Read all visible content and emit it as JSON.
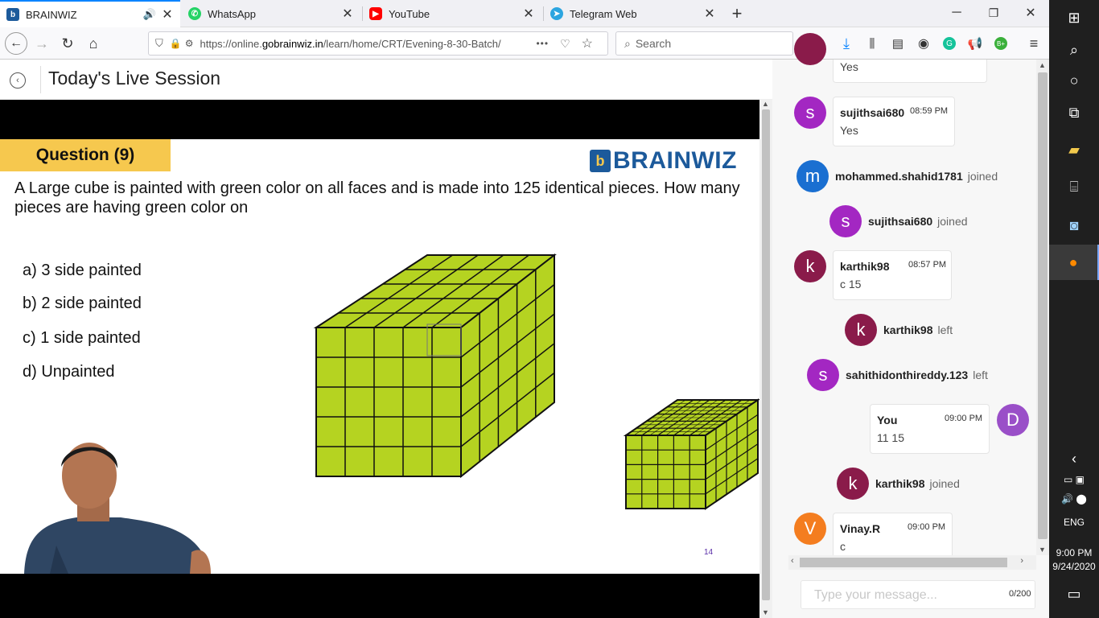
{
  "browser": {
    "tabs": [
      {
        "label": "BRAINWIZ",
        "icon": "brainwiz-favicon",
        "active": true
      },
      {
        "label": "WhatsApp",
        "icon": "whatsapp-icon"
      },
      {
        "label": "YouTube",
        "icon": "youtube-icon"
      },
      {
        "label": "Telegram Web",
        "icon": "telegram-icon"
      }
    ],
    "url_prefix": "https://online.",
    "url_domain": "gobrainwiz.in",
    "url_path": "/learn/home/CRT/Evening-8-30-Batch/",
    "search_placeholder": "Search",
    "overflow": "•••",
    "newtab": "+"
  },
  "page": {
    "title": "Today's Live Session"
  },
  "slide": {
    "badge": "Question (9)",
    "brand": "BRAINWIZ",
    "brand_mark": "b",
    "question": "A Large cube is painted with green color on all faces and is made into 125 identical pieces. How many pieces are having green color on",
    "options": [
      "a) 3 side painted",
      "b) 2 side painted",
      "c) 1 side painted",
      "d) Unpainted"
    ],
    "page_number": "14",
    "cube_color": "#b5d321"
  },
  "chat": {
    "top_msg": "Yes",
    "messages": [
      {
        "avatar": "s",
        "color": "#a327c2",
        "user": "sujithsai680",
        "time": "08:59 PM",
        "text": "Yes"
      },
      {
        "avatar": "k",
        "color": "#8a1b4a",
        "user": "karthik98",
        "time": "08:57 PM",
        "text": "c 15"
      },
      {
        "avatar": "D",
        "color": "#9a4fc8",
        "user": "You",
        "time": "09:00 PM",
        "text": "11 15"
      },
      {
        "avatar": "V",
        "color": "#f47d1f",
        "user": "Vinay.R",
        "time": "09:00 PM",
        "text": "c"
      }
    ],
    "events": [
      {
        "avatar": "m",
        "color": "#1a6fd1",
        "user": "mohammed.shahid1781",
        "action": "joined"
      },
      {
        "avatar": "s",
        "color": "#a327c2",
        "user": "sujithsai680",
        "action": "joined"
      },
      {
        "avatar": "k",
        "color": "#8a1b4a",
        "user": "karthik98",
        "action": "left"
      },
      {
        "avatar": "s",
        "color": "#a327c2",
        "user": "sahithidonthireddy.123",
        "action": "left"
      },
      {
        "avatar": "k",
        "color": "#8a1b4a",
        "user": "karthik98",
        "action": "joined"
      }
    ],
    "input_placeholder": "Type your message...",
    "char_count": "0/200"
  },
  "taskbar": {
    "lang": "ENG",
    "time": "9:00 PM",
    "date": "9/24/2020"
  }
}
